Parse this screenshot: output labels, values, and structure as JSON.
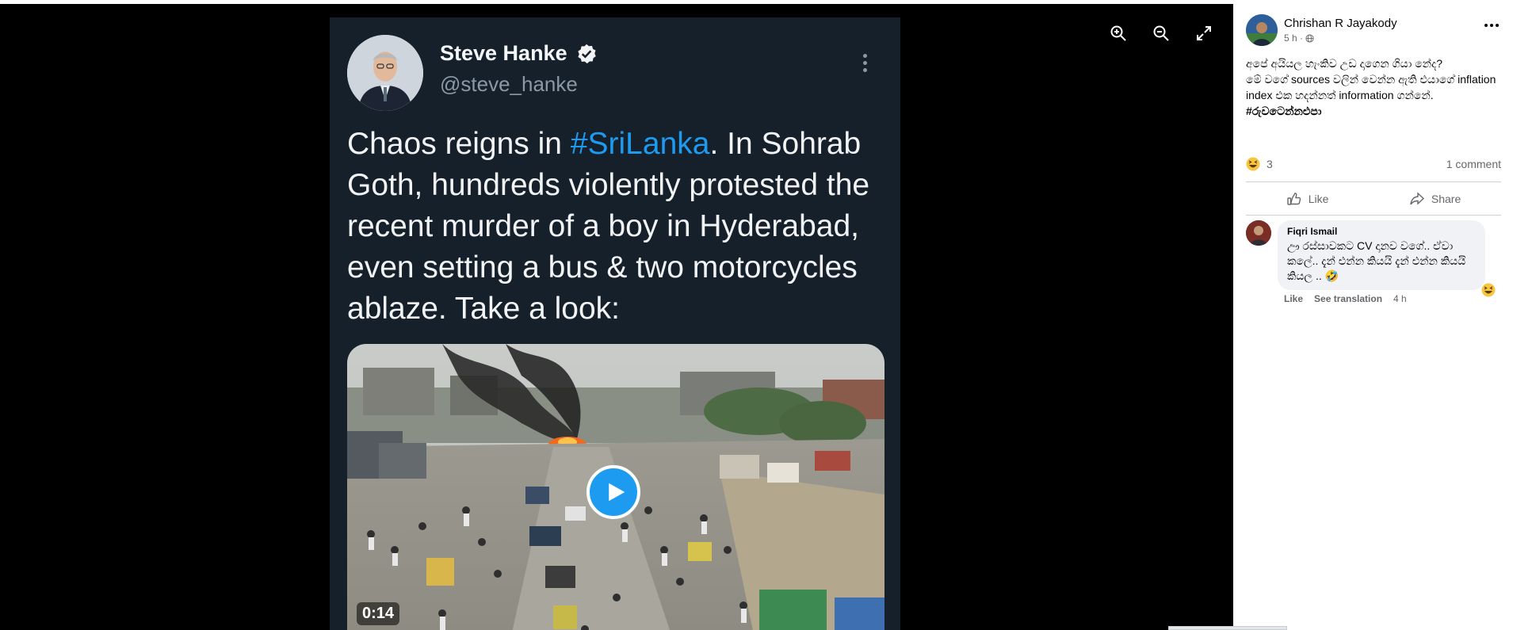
{
  "viewer": {
    "tools": [
      "zoom-in",
      "zoom-out",
      "fullscreen"
    ]
  },
  "tweet": {
    "name": "Steve Hanke",
    "handle": "@steve_hanke",
    "text_before": "Chaos reigns in ",
    "hashtag": "#SriLanka",
    "text_after": ". In Sohrab Goth, hundreds violently protested the recent murder of a boy in Hyderabad, even setting a bus & two motorcycles ablaze. Take a look:",
    "video_duration": "0:14",
    "colors": {
      "background": "#15202b",
      "accent": "#1d9bf0"
    }
  },
  "post": {
    "author": "Chrishan R Jayakody",
    "time": "5 h ·",
    "body_line1": "අපේ අයියල හැංකිව උඩ දාගෙන ගියා නේද?",
    "body_line2": "මේ වගේ sources වලින් වෙන්න ඇති එයාගේ inflation index එක හදන්නත් information ගන්නේ.",
    "hashtag": "#රුවටෙන්නඑපා",
    "reaction_count": "3",
    "comment_count": "1 comment",
    "like_label": "Like",
    "share_label": "Share"
  },
  "comment": {
    "author": "Fiqri Ismail",
    "text": "ඌ රස්සාවකට CV දානව වගේ.. ඒවා කලේ.. දැන් එන්න කියයි දැන් එන්න කියයි කියල .. 🤣",
    "like_label": "Like",
    "translate_label": "See translation",
    "time": "4 h"
  }
}
